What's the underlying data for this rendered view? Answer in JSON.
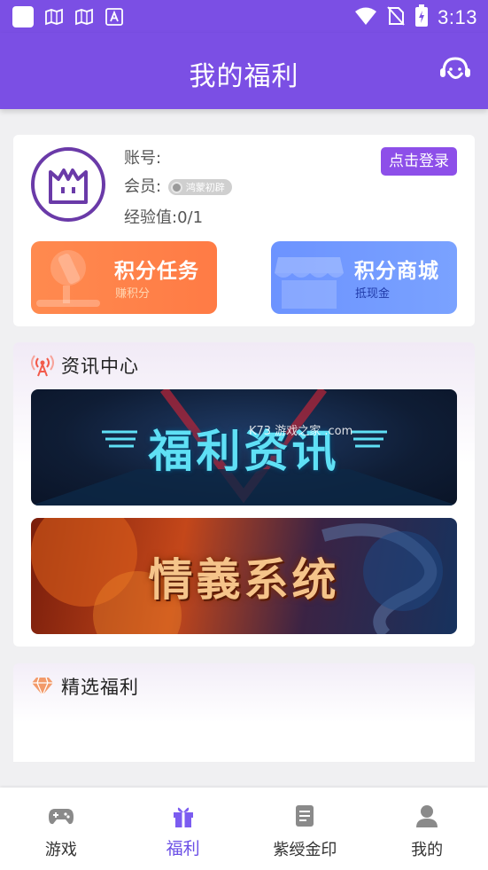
{
  "status_bar": {
    "time": "3:13",
    "left_icons": [
      "app-notification-icon",
      "gallery-icon",
      "gallery-icon",
      "font-app-icon"
    ],
    "right_icons": [
      "wifi-icon",
      "no-sim-icon",
      "battery-charging-icon"
    ]
  },
  "header": {
    "title": "我的福利",
    "right_icon": "customer-service-icon"
  },
  "user_card": {
    "account_label": "账号:",
    "account_value": "",
    "member_label": "会员:",
    "member_level": "鸿蒙初辟",
    "exp_label": "经验值:",
    "exp_value": "0/1",
    "login_button": "点击登录"
  },
  "tiles": [
    {
      "title": "积分任务",
      "subtitle": "赚积分",
      "icon": "microscope-icon"
    },
    {
      "title": "积分商城",
      "subtitle": "抵现金",
      "icon": "store-icon"
    }
  ],
  "news_section": {
    "title": "资讯中心",
    "icon": "broadcast-icon",
    "banners": [
      {
        "text": "福利资讯",
        "watermark": "K73 游戏之家 .com"
      },
      {
        "text": "情義系统"
      }
    ]
  },
  "selected_section": {
    "title": "精选福利",
    "icon": "diamond-icon"
  },
  "bottom_nav": [
    {
      "label": "游戏",
      "icon": "gamepad-icon",
      "active": false
    },
    {
      "label": "福利",
      "icon": "gift-icon",
      "active": true
    },
    {
      "label": "紫绶金印",
      "icon": "document-icon",
      "active": false
    },
    {
      "label": "我的",
      "icon": "user-icon",
      "active": false
    }
  ],
  "colors": {
    "primary": "#7b4fe4",
    "login_button": "#8d4fe9",
    "task_tile": "#ff8048",
    "shop_tile": "#7299ff",
    "nav_active": "#6b4fe6"
  }
}
